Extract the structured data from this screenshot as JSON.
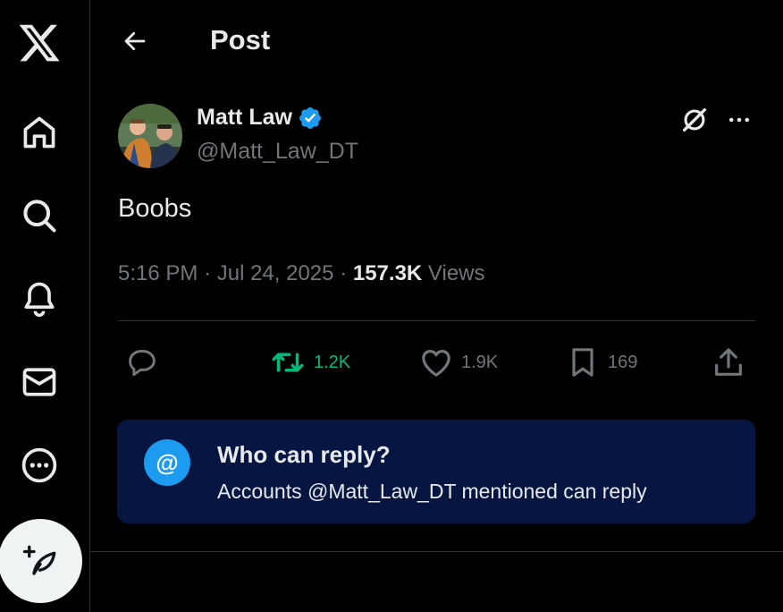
{
  "header": {
    "title": "Post"
  },
  "nav": {
    "items": [
      {
        "name": "x-logo-icon"
      },
      {
        "name": "home-icon"
      },
      {
        "name": "search-icon"
      },
      {
        "name": "notifications-icon"
      },
      {
        "name": "messages-icon"
      },
      {
        "name": "more-icon"
      }
    ],
    "compose_icon": "compose-post-icon"
  },
  "post": {
    "display_name": "Matt Law",
    "verified": true,
    "handle": "@Matt_Law_DT",
    "text": "Boobs",
    "time": "5:16 PM",
    "date": "Jul 24, 2025",
    "separator": "·",
    "views_count": "157.3K",
    "views_label": "Views"
  },
  "actions": {
    "reply_count": "",
    "retweet_count": "1.2K",
    "like_count": "1.9K",
    "bookmark_count": "169"
  },
  "reply_restriction": {
    "icon_glyph": "@",
    "title": "Who can reply?",
    "subtitle": "Accounts @Matt_Law_DT mentioned can reply"
  },
  "colors": {
    "background": "#000000",
    "text": "#e7e9ea",
    "muted": "#71767b",
    "accent": "#1d9bf0",
    "retweet_active": "#00ba7c",
    "banner_bg": "#061641",
    "border": "#2f3336"
  }
}
